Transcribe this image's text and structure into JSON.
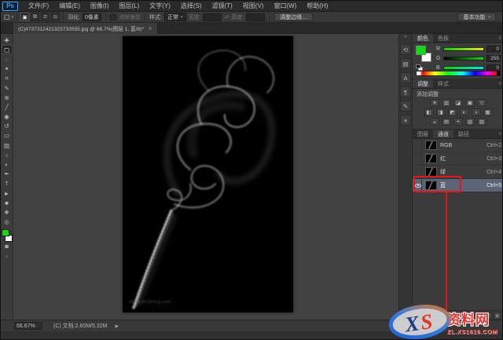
{
  "app": {
    "logo": "Ps"
  },
  "menu_bar": {
    "items": [
      "文件(F)",
      "编辑(E)",
      "图像(I)",
      "图层(L)",
      "文字(Y)",
      "选择(S)",
      "滤镜(T)",
      "视图(V)",
      "窗口(W)",
      "帮助(H)"
    ]
  },
  "options_bar": {
    "tool_icon": "▢",
    "tool_arrow": "▾",
    "mode_icons": [
      "▣",
      "⧉",
      "⧄",
      "⧅"
    ],
    "feather_label": "羽化:",
    "feather_value": "0像素",
    "antialias_label": "消除锯齿",
    "style_label": "样式:",
    "style_value": "正常",
    "width_label": "宽度:",
    "width_value": "",
    "swap_icon": "⇄",
    "height_label": "高度:",
    "height_value": "",
    "refine_edge": "调整边缘…",
    "workspace": "基本功能",
    "workspace_arrow": "▾"
  },
  "document_tab": {
    "title": "(C)4737312421323733555.jpg @ 66.7%(图层 1, 蓝/8)*",
    "close": "×"
  },
  "toolbar": {
    "tools": [
      {
        "name": "move-tool",
        "glyph": "✚"
      },
      {
        "name": "marquee-tool",
        "glyph": "▢"
      },
      {
        "name": "lasso-tool",
        "glyph": "◌"
      },
      {
        "name": "magic-wand-tool",
        "glyph": "✦"
      },
      {
        "name": "crop-tool",
        "glyph": "⌗"
      },
      {
        "name": "eyedropper-tool",
        "glyph": "✎"
      },
      {
        "name": "healing-brush-tool",
        "glyph": "⊕"
      },
      {
        "name": "brush-tool",
        "glyph": "╱"
      },
      {
        "name": "clone-stamp-tool",
        "glyph": "◉"
      },
      {
        "name": "history-brush-tool",
        "glyph": "↺"
      },
      {
        "name": "eraser-tool",
        "glyph": "▭"
      },
      {
        "name": "gradient-tool",
        "glyph": "▨"
      },
      {
        "name": "blur-tool",
        "glyph": "○"
      },
      {
        "name": "dodge-tool",
        "glyph": "◐"
      },
      {
        "name": "pen-tool",
        "glyph": "✒"
      },
      {
        "name": "type-tool",
        "glyph": "T"
      },
      {
        "name": "path-select-tool",
        "glyph": "►"
      },
      {
        "name": "shape-tool",
        "glyph": "■"
      },
      {
        "name": "hand-tool",
        "glyph": "❖"
      },
      {
        "name": "zoom-tool",
        "glyph": "◎"
      }
    ],
    "quick_mask_glyph": "◙",
    "screen_mode_glyph": "▫",
    "foreground_color": "#0ae00a",
    "background_color": "#ffffff"
  },
  "dock_strip": {
    "expand": "«",
    "icons": [
      {
        "name": "dock-history-icon",
        "glyph": "⟲"
      },
      {
        "name": "dock-properties-icon",
        "glyph": "▤"
      },
      {
        "name": "dock-character-icon",
        "glyph": "A"
      },
      {
        "name": "dock-paragraph-icon",
        "glyph": "¶"
      },
      {
        "name": "dock-notes-icon",
        "glyph": "✎"
      },
      {
        "name": "dock-clone-source-icon",
        "glyph": "≡"
      }
    ]
  },
  "color_panel": {
    "tabs": [
      "颜色",
      "色板"
    ],
    "menu_icon": "≡",
    "sliders": [
      {
        "label": "R",
        "value": "0"
      },
      {
        "label": "G",
        "value": "255"
      },
      {
        "label": "B",
        "value": "0"
      }
    ],
    "foreground": "#0ae00a",
    "background": "#ffffff"
  },
  "adjustments_panel": {
    "tabs": [
      "调整",
      "样式"
    ],
    "menu_icon": "≡",
    "header": "添加调整",
    "icons": [
      {
        "name": "brightness-contrast-icon",
        "glyph": "☀"
      },
      {
        "name": "levels-icon",
        "glyph": "▥"
      },
      {
        "name": "curves-icon",
        "glyph": "◪"
      },
      {
        "name": "exposure-icon",
        "glyph": "▣"
      },
      {
        "name": "vibrance-icon",
        "glyph": "▽"
      },
      {
        "name": "hue-saturation-icon",
        "glyph": "◧"
      },
      {
        "name": "color-balance-icon",
        "glyph": "◨"
      },
      {
        "name": "black-white-icon",
        "glyph": "◩"
      },
      {
        "name": "photo-filter-icon",
        "glyph": "◐"
      },
      {
        "name": "channel-mixer-icon",
        "glyph": "◑"
      },
      {
        "name": "color-lookup-icon",
        "glyph": "▦"
      },
      {
        "name": "invert-icon",
        "glyph": "◒"
      },
      {
        "name": "posterize-icon",
        "glyph": "▤"
      },
      {
        "name": "threshold-icon",
        "glyph": "◓"
      },
      {
        "name": "gradient-map-icon",
        "glyph": "▨"
      },
      {
        "name": "selective-color-icon",
        "glyph": "▧"
      }
    ]
  },
  "channels_panel": {
    "tabs": [
      "图层",
      "通道",
      "路径"
    ],
    "menu_icon": "≡",
    "rows": [
      {
        "label": "RGB",
        "shortcut": "Ctrl+2"
      },
      {
        "label": "红",
        "shortcut": "Ctrl+3"
      },
      {
        "label": "绿",
        "shortcut": "Ctrl+4"
      },
      {
        "label": "蓝",
        "shortcut": "Ctrl+5"
      }
    ],
    "footer_icons": [
      "◌",
      "▢",
      "⊞",
      "▣"
    ]
  },
  "status_bar": {
    "zoom": "66.67%",
    "doc_info": "(C) 文档:2.60M/5.32M",
    "arrow": "▶"
  },
  "canvas": {
    "image_watermark": "stock.tuchong.com"
  },
  "site_watermark": {
    "logo": "XS",
    "name": "资料网",
    "url": "ZL.XS1616.COM"
  },
  "colors": {
    "annotation_red": "#e81416",
    "selected_channel_row": "#5c6577",
    "foreground_green": "#0ae00a"
  }
}
